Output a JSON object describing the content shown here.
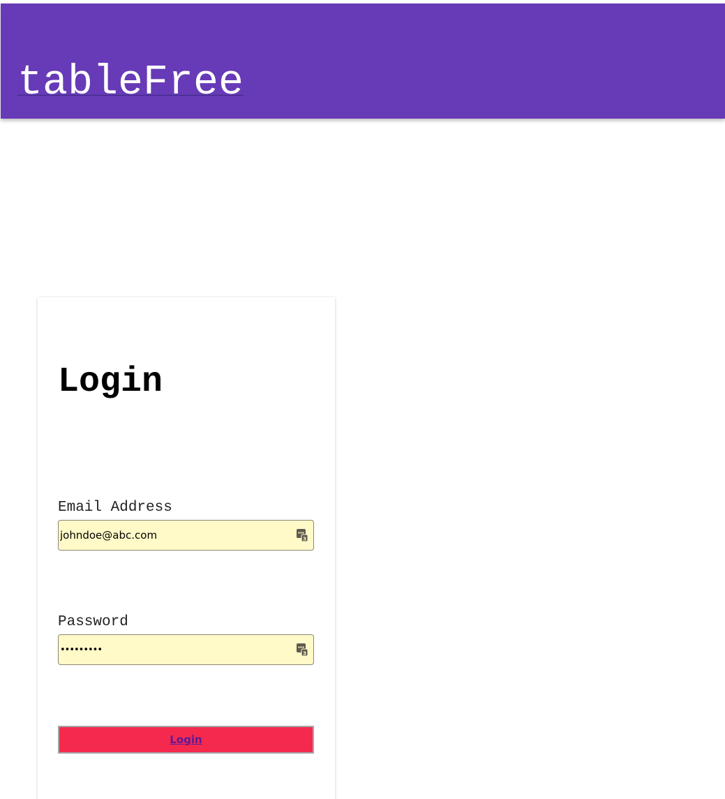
{
  "header": {
    "brand": "tableFree",
    "background_color": "#673ab7"
  },
  "login_card": {
    "title": "Login",
    "email": {
      "label": "Email Address",
      "value": "johndoe@abc.com",
      "icon": "password-manager-icon"
    },
    "password": {
      "label": "Password",
      "value": "•••••••••",
      "icon": "password-manager-icon"
    },
    "submit_label": "Login",
    "submit_color": "#f5294d",
    "autofill_color": "#fffac8"
  }
}
